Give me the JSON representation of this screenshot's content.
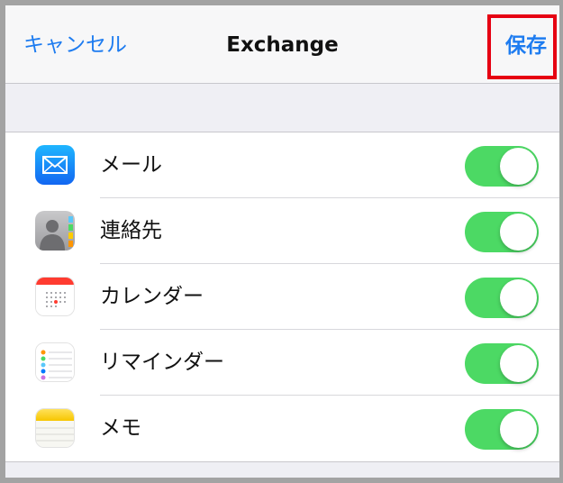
{
  "nav": {
    "cancel": "キャンセル",
    "title": "Exchange",
    "save": "保存"
  },
  "items": [
    {
      "label": "メール",
      "icon": "mail-icon",
      "enabled": true
    },
    {
      "label": "連絡先",
      "icon": "contacts-icon",
      "enabled": true
    },
    {
      "label": "カレンダー",
      "icon": "calendar-icon",
      "enabled": true
    },
    {
      "label": "リマインダー",
      "icon": "reminders-icon",
      "enabled": true
    },
    {
      "label": "メモ",
      "icon": "notes-icon",
      "enabled": true
    }
  ],
  "colors": {
    "accent": "#1e7cf0",
    "toggle_on": "#4cd964",
    "highlight": "#e60012"
  }
}
